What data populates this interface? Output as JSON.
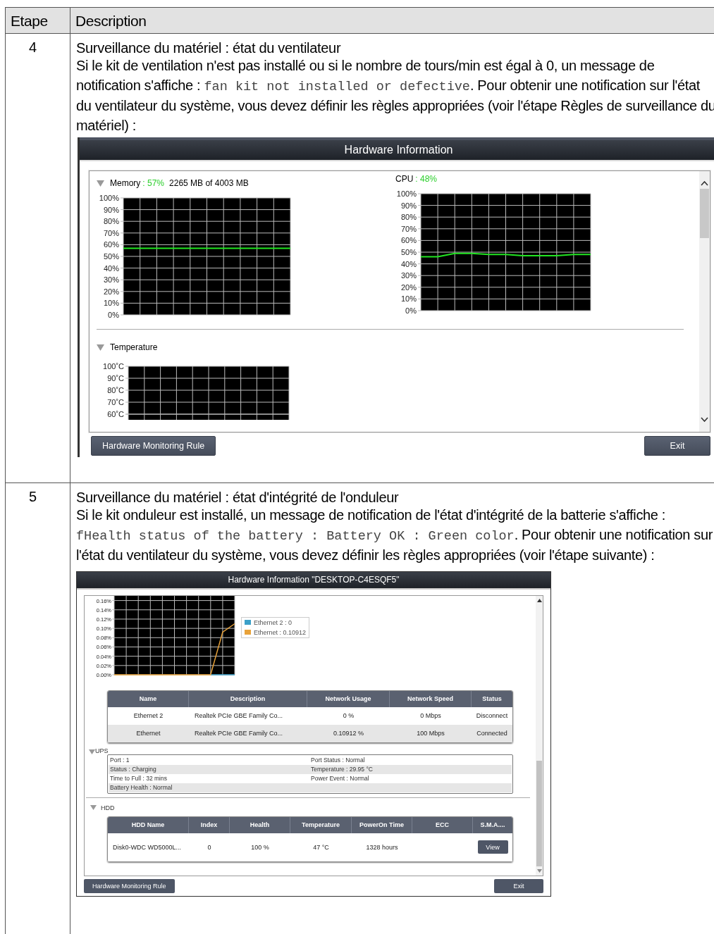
{
  "table": {
    "columns": [
      "Etape",
      "Description"
    ],
    "rows": [
      {
        "step": "4",
        "title": "Surveillance du matériel : état du ventilateur",
        "paragraph": [
          {
            "kind": "text",
            "text": "Si le kit de ventilation n'est pas installé ou si le nombre de tours/min est égal à 0, un message de notification s'affiche : "
          },
          {
            "kind": "code",
            "text": "fan kit not installed or defective"
          },
          {
            "kind": "text",
            "text": ". Pour obtenir une notification sur l'état du ventilateur du système, vous devez définir les règles appropriées (voir l'étape Règles de surveillance du matériel) :"
          }
        ],
        "screenshot": {
          "kind": "overview",
          "title": "Hardware Information",
          "memory": {
            "label": "Memory",
            "value": ": 57%",
            "detail": "2265 MB of 4003 MB",
            "chart_data": {
              "type": "line",
              "grid": true,
              "ylim": [
                0,
                100
              ],
              "yticks": [
                {
                  "value": 0,
                  "label": "0%"
                },
                {
                  "value": 10,
                  "label": "10%"
                },
                {
                  "value": 20,
                  "label": "20%"
                },
                {
                  "value": 30,
                  "label": "30%"
                },
                {
                  "value": 40,
                  "label": "40%"
                },
                {
                  "value": 50,
                  "label": "50%"
                },
                {
                  "value": 60,
                  "label": "60%"
                },
                {
                  "value": 70,
                  "label": "70%"
                },
                {
                  "value": 80,
                  "label": "80%"
                },
                {
                  "value": 90,
                  "label": "90%"
                },
                {
                  "value": 100,
                  "label": "100%"
                }
              ],
              "series": [
                {
                  "color": "#22e622",
                  "values": [
                    57,
                    57,
                    57,
                    57,
                    57,
                    57,
                    57,
                    57,
                    57,
                    57,
                    57
                  ]
                }
              ]
            }
          },
          "cpu": {
            "label": "CPU",
            "value": ": 48%",
            "chart_data": {
              "type": "line",
              "grid": true,
              "ylim": [
                0,
                100
              ],
              "yticks": [
                {
                  "value": 0,
                  "label": "0%"
                },
                {
                  "value": 10,
                  "label": "10%"
                },
                {
                  "value": 20,
                  "label": "20%"
                },
                {
                  "value": 30,
                  "label": "30%"
                },
                {
                  "value": 40,
                  "label": "40%"
                },
                {
                  "value": 50,
                  "label": "50%"
                },
                {
                  "value": 60,
                  "label": "60%"
                },
                {
                  "value": 70,
                  "label": "70%"
                },
                {
                  "value": 80,
                  "label": "80%"
                },
                {
                  "value": 90,
                  "label": "90%"
                },
                {
                  "value": 100,
                  "label": "100%"
                }
              ],
              "series": [
                {
                  "color": "#22e622",
                  "values": [
                    46,
                    46,
                    49,
                    49,
                    48,
                    48,
                    47,
                    47,
                    47,
                    48,
                    48
                  ]
                }
              ]
            }
          },
          "temperature": {
            "label": "Temperature",
            "tick_labels": [
              "100˚C",
              "90˚C",
              "80˚C",
              "70˚C",
              "60˚C"
            ]
          },
          "buttons": [
            "Hardware Monitoring Rule",
            "Exit"
          ]
        }
      },
      {
        "step": "5",
        "title": "Surveillance du matériel : état d'intégrité de l'onduleur",
        "paragraph": [
          {
            "kind": "text",
            "text": "Si le kit onduleur est installé, un message de notification de l'état d'intégrité de la batterie s'affiche : "
          },
          {
            "kind": "code",
            "text": "fHealth status of the battery : Battery OK : Green color"
          },
          {
            "kind": "text",
            "text": ". Pour obtenir une notification sur l'état du ventilateur du système, vous devez définir les règles appropriées (voir l'étape suivante) :"
          }
        ],
        "screenshot": {
          "kind": "details",
          "title": "Hardware Information \"DESKTOP-C4ESQF5\"",
          "network": {
            "chart_data": {
              "type": "line",
              "grid": true,
              "ylim": [
                0,
                0.17
              ],
              "yticks": [
                {
                  "value": 0,
                  "label": "0.00%"
                },
                {
                  "value": 0.02,
                  "label": "0.02%"
                },
                {
                  "value": 0.04,
                  "label": "0.04%"
                },
                {
                  "value": 0.06,
                  "label": "0.06%"
                },
                {
                  "value": 0.08,
                  "label": "0.08%"
                },
                {
                  "value": 0.1,
                  "label": "0.10%"
                },
                {
                  "value": 0.12,
                  "label": "0.12%"
                },
                {
                  "value": 0.14,
                  "label": "0.14%"
                },
                {
                  "value": 0.16,
                  "label": "0.16%"
                }
              ],
              "series": [
                {
                  "name": "Ethernet 2 : 0",
                  "color": "#3ca0c8",
                  "values": [
                    null,
                    null,
                    null,
                    null,
                    null,
                    null,
                    null,
                    null,
                    0,
                    0,
                    0
                  ]
                },
                {
                  "name": "Ethernet : 0.10912",
                  "color": "#e8a23a",
                  "values": [
                    0,
                    0,
                    0,
                    0,
                    0,
                    0,
                    0,
                    0,
                    0,
                    0.092,
                    0.11
                  ]
                }
              ]
            },
            "columns": [
              "Name",
              "Description",
              "Network Usage",
              "Network Speed",
              "Status"
            ],
            "rows": [
              [
                "Ethernet 2",
                "Realtek PCIe GBE Family Co...",
                "0 %",
                "0 Mbps",
                "Disconnect"
              ],
              [
                "Ethernet",
                "Realtek PCIe GBE Family Co...",
                "0.10912 %",
                "100 Mbps",
                "Connected"
              ]
            ]
          },
          "ups": {
            "label": "UPS",
            "rows": [
              {
                "left": "Port : 1",
                "right": "Port Status : Normal"
              },
              {
                "left": "Status : Charging",
                "right": "Temperature : 29.95 °C"
              },
              {
                "left": "Time to Full : 32 mins",
                "right": "Power Event : Normal"
              },
              {
                "left": "Battery Health : Normal"
              }
            ]
          },
          "hdd": {
            "label": "HDD",
            "columns": [
              "HDD Name",
              "Index",
              "Health",
              "Temperature",
              "PowerOn Time",
              "ECC",
              "S.M.A...."
            ],
            "rows": [
              [
                {
                  "kind": "text",
                  "text": "Disk0-WDC WD5000L..."
                },
                {
                  "kind": "text",
                  "text": "0"
                },
                {
                  "kind": "text",
                  "text": "100 %"
                },
                {
                  "kind": "text",
                  "text": "47 °C"
                },
                {
                  "kind": "text",
                  "text": "1328 hours"
                },
                {
                  "kind": "empty"
                },
                {
                  "kind": "button",
                  "text": "View"
                }
              ]
            ]
          },
          "buttons": [
            "Hardware Monitoring Rule",
            "Exit"
          ]
        }
      }
    ]
  }
}
